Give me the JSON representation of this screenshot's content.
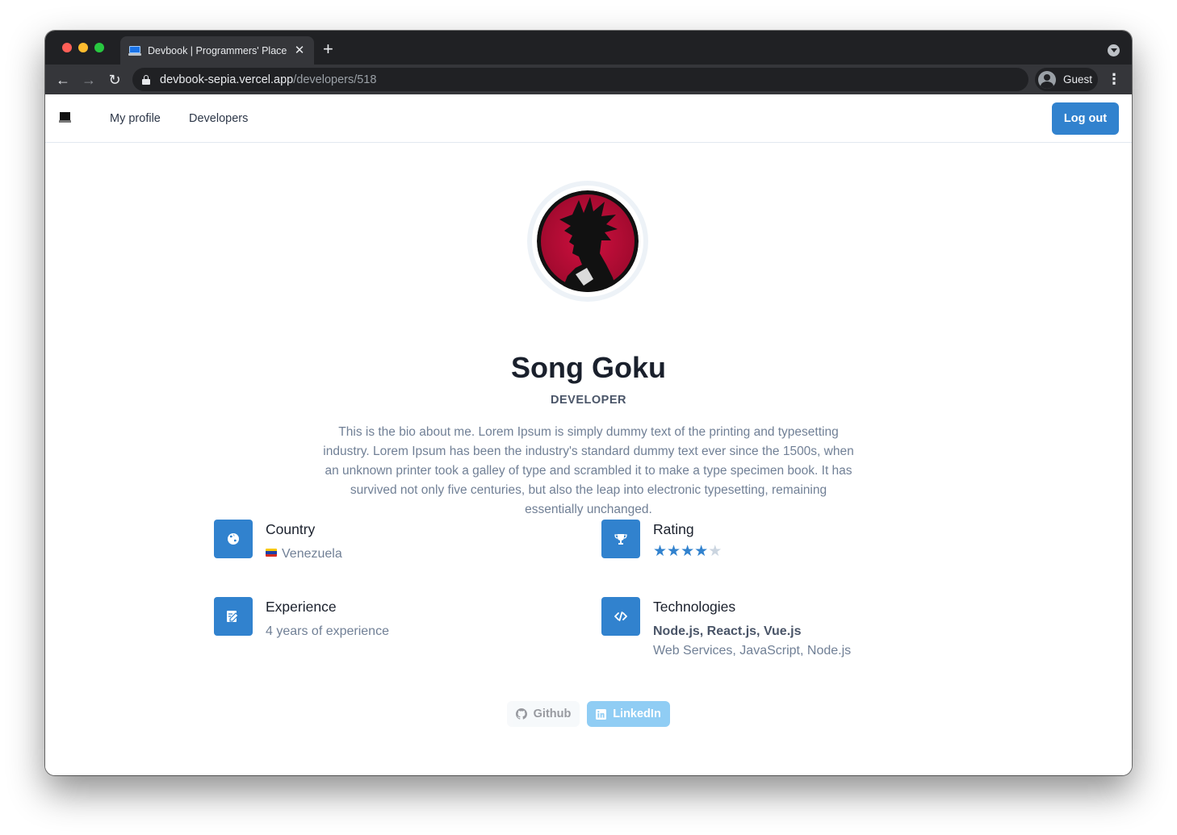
{
  "browser": {
    "tab_title": "Devbook | Programmers' Place",
    "tab_close": "✕",
    "new_tab": "+",
    "url_host": "devbook-sepia.vercel.app",
    "url_path": "/developers/518",
    "profile_label": "Guest",
    "back": "←",
    "forward": "→",
    "reload": "↻",
    "menu": "⋮"
  },
  "navbar": {
    "links": [
      "My profile",
      "Developers"
    ],
    "logout_label": "Log out"
  },
  "profile": {
    "name": "Song Goku",
    "role": "DEVELOPER",
    "bio": "This is the bio about me. Lorem Ipsum is simply dummy text of the printing and typesetting industry. Lorem Ipsum has been the industry's standard dummy text ever since the 1500s, when an unknown printer took a galley of type and scrambled it to make a type specimen book. It has survived not only five centuries, but also the leap into electronic typesetting, remaining essentially unchanged."
  },
  "features": {
    "country": {
      "title": "Country",
      "value": "Venezuela",
      "icon": "globe-icon"
    },
    "rating": {
      "title": "Rating",
      "stars_filled": 4,
      "stars_total": 5,
      "star_glyph": "★",
      "icon": "trophy-icon"
    },
    "experience": {
      "title": "Experience",
      "value": "4 years of experience",
      "icon": "edit-icon"
    },
    "technologies": {
      "title": "Technologies",
      "main": "Node.js, React.js, Vue.js",
      "secondary": "Web Services, JavaScript, Node.js",
      "icon": "code-icon"
    }
  },
  "social": {
    "github_label": "Github",
    "linkedin_label": "LinkedIn"
  },
  "colors": {
    "accent": "#3182ce",
    "star_filled": "#3182ce",
    "star_empty": "#cbd5e0",
    "linkedin_bg": "#90cdf4"
  }
}
